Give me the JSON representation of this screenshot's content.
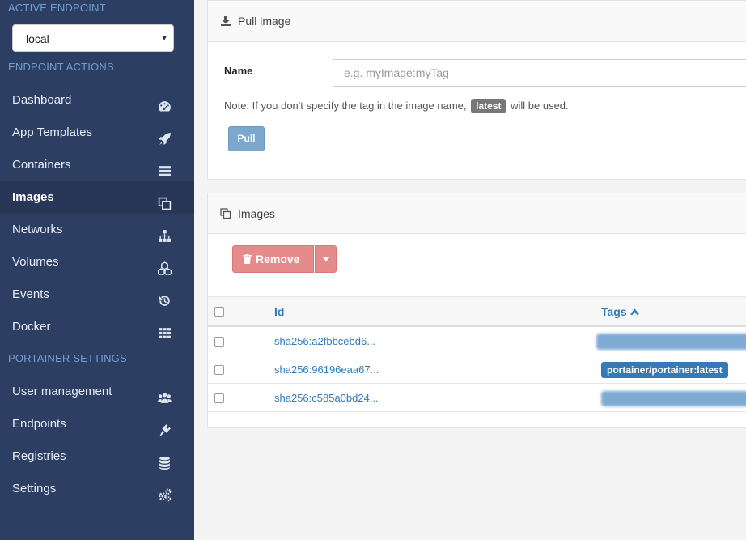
{
  "sidebar": {
    "active_endpoint_heading": "ACTIVE ENDPOINT",
    "endpoint_select": "local",
    "endpoint_actions_heading": "ENDPOINT ACTIONS",
    "endpoint_items": [
      {
        "label": "Dashboard",
        "icon": "dashboard-icon"
      },
      {
        "label": "App Templates",
        "icon": "rocket-icon"
      },
      {
        "label": "Containers",
        "icon": "server-icon"
      },
      {
        "label": "Images",
        "icon": "clone-icon"
      },
      {
        "label": "Networks",
        "icon": "sitemap-icon"
      },
      {
        "label": "Volumes",
        "icon": "cubes-icon"
      },
      {
        "label": "Events",
        "icon": "history-icon"
      },
      {
        "label": "Docker",
        "icon": "th-icon"
      }
    ],
    "portainer_settings_heading": "PORTAINER SETTINGS",
    "settings_items": [
      {
        "label": "User management",
        "icon": "users-icon"
      },
      {
        "label": "Endpoints",
        "icon": "plug-icon"
      },
      {
        "label": "Registries",
        "icon": "database-icon"
      },
      {
        "label": "Settings",
        "icon": "cogs-icon"
      }
    ],
    "active_item": "Images"
  },
  "pull_panel": {
    "title": "Pull image",
    "name_label": "Name",
    "name_placeholder": "e.g. myImage:myTag",
    "note_before": "Note: If you don't specify the tag in the image name,",
    "note_badge": "latest",
    "note_after": "will be used.",
    "pull_button": "Pull"
  },
  "images_panel": {
    "title": "Images",
    "remove_button": "Remove",
    "columns": {
      "id": "Id",
      "tags": "Tags"
    },
    "rows": [
      {
        "id": "sha256:a2fbbcebd6...",
        "tag": ""
      },
      {
        "id": "sha256:96196eaa67...",
        "tag": "portainer/portainer:latest"
      },
      {
        "id": "sha256:c585a0bd24...",
        "tag": ""
      }
    ]
  },
  "colors": {
    "sidebar_bg": "#2d3e63",
    "sidebar_heading": "#6f9fd2",
    "link": "#337ab7",
    "danger": "#e68b8b"
  }
}
